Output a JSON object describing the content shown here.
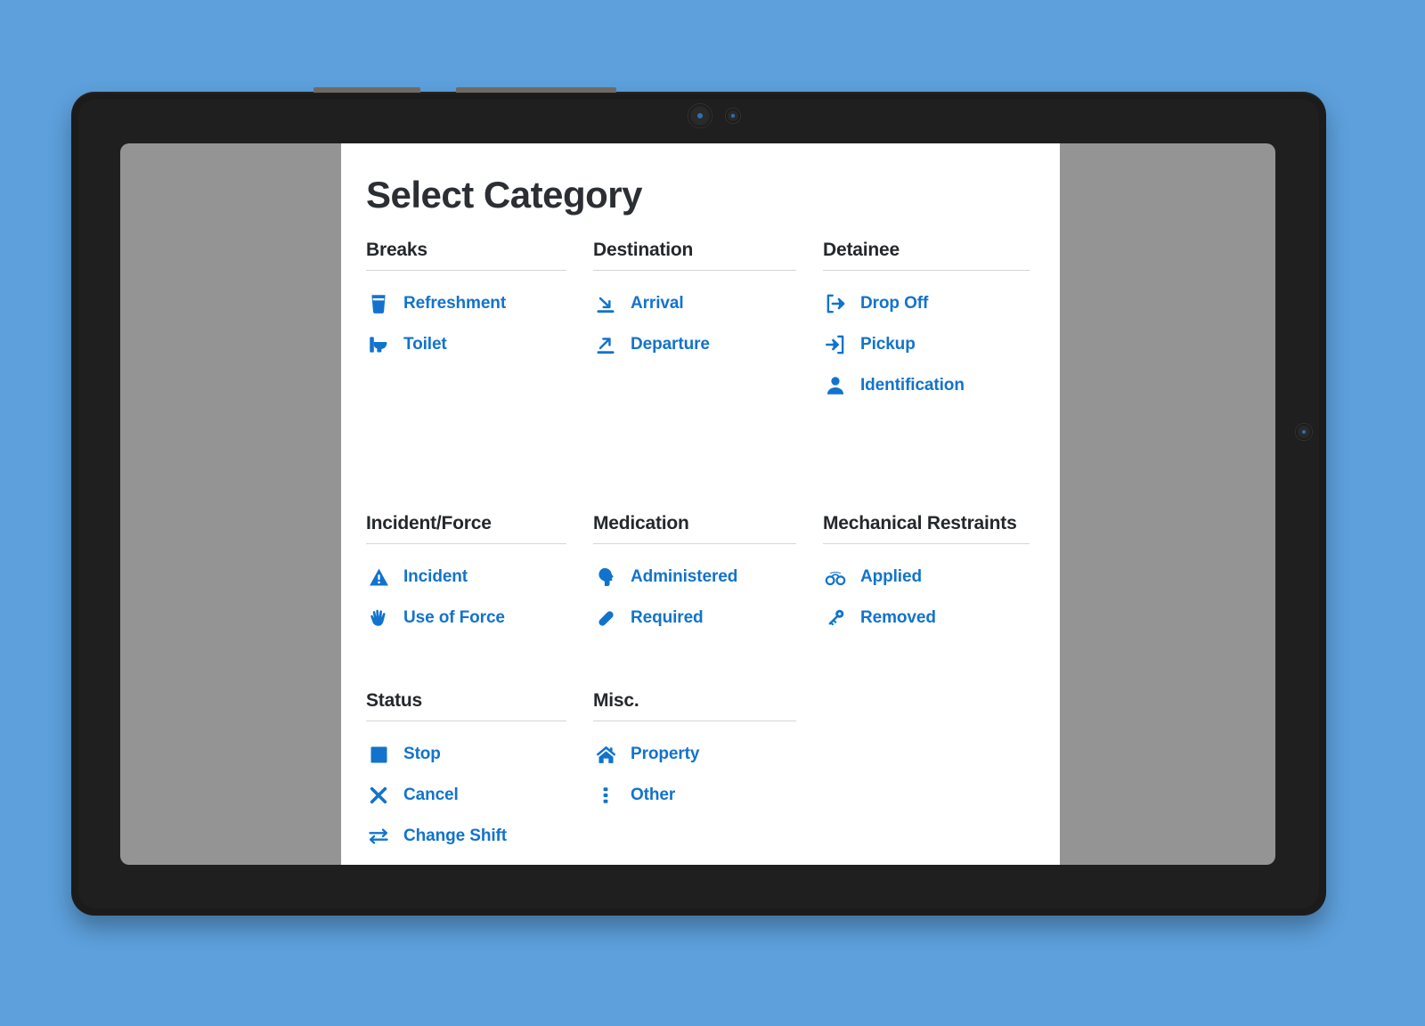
{
  "app": {
    "title": "Select Category",
    "accent_color": "#1273cc",
    "title_color": "#2b2f33",
    "panel_background": "#ffffff",
    "screen_background": "#949494",
    "device_background": "#1b1b1b",
    "page_background": "#5da0dc"
  },
  "device": {
    "front_camera_label": "front-camera",
    "ambient_sensor_label": "ambient-sensor",
    "side_sensor_label": "side-sensor"
  },
  "rows": [
    {
      "groups": [
        {
          "header": "Breaks",
          "items": [
            {
              "label": "Refreshment",
              "icon": "cup-icon"
            },
            {
              "label": "Toilet",
              "icon": "toilet-icon"
            }
          ]
        },
        {
          "header": "Destination",
          "items": [
            {
              "label": "Arrival",
              "icon": "arrival-arrow-icon"
            },
            {
              "label": "Departure",
              "icon": "departure-arrow-icon"
            }
          ]
        },
        {
          "header": "Detainee",
          "items": [
            {
              "label": "Drop Off",
              "icon": "sign-out-icon"
            },
            {
              "label": "Pickup",
              "icon": "sign-in-icon"
            },
            {
              "label": "Identification",
              "icon": "person-icon"
            }
          ]
        }
      ]
    },
    {
      "groups": [
        {
          "header": "Incident/Force",
          "items": [
            {
              "label": "Incident",
              "icon": "warning-triangle-icon"
            },
            {
              "label": "Use of Force",
              "icon": "hand-icon"
            }
          ]
        },
        {
          "header": "Medication",
          "items": [
            {
              "label": "Administered",
              "icon": "head-profile-icon"
            },
            {
              "label": "Required",
              "icon": "pill-capsule-icon"
            }
          ]
        },
        {
          "header": "Mechanical Restraints",
          "items": [
            {
              "label": "Applied",
              "icon": "handcuffs-icon"
            },
            {
              "label": "Removed",
              "icon": "key-icon"
            }
          ]
        }
      ]
    },
    {
      "groups": [
        {
          "header": "Status",
          "items": [
            {
              "label": "Stop",
              "icon": "stop-square-icon"
            },
            {
              "label": "Cancel",
              "icon": "cross-x-icon"
            },
            {
              "label": "Change Shift",
              "icon": "exchange-arrows-icon"
            }
          ]
        },
        {
          "header": "Misc.",
          "items": [
            {
              "label": "Property",
              "icon": "home-icon"
            },
            {
              "label": "Other",
              "icon": "vertical-dots-icon"
            }
          ]
        }
      ]
    }
  ]
}
